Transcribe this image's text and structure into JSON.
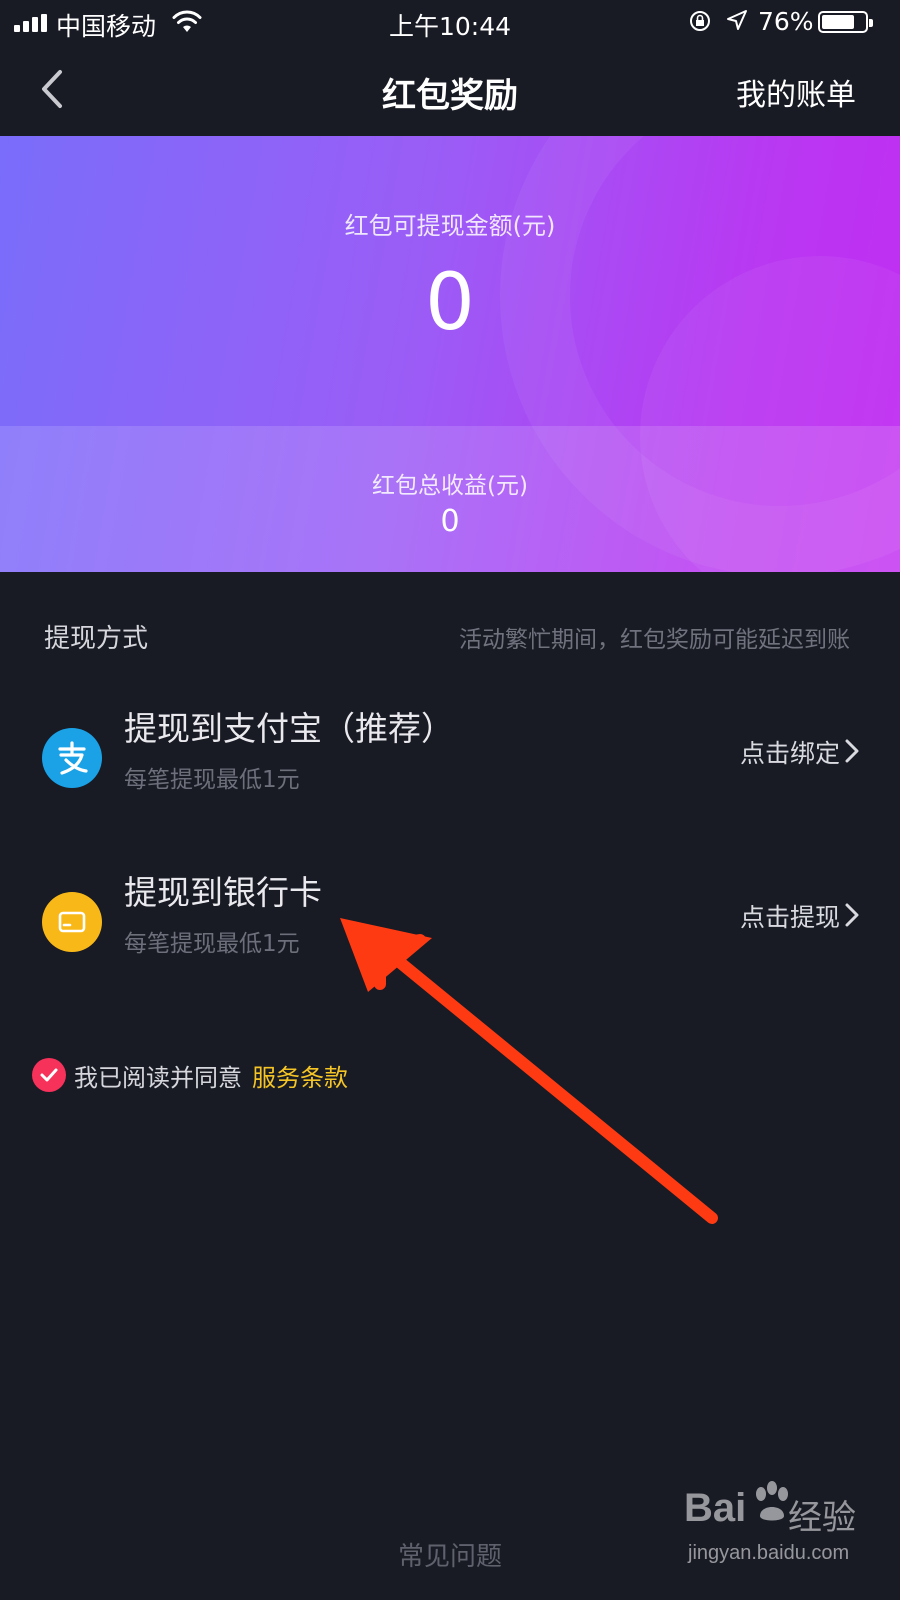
{
  "status_bar": {
    "carrier": "中国移动",
    "time": "上午10:44",
    "battery_percent": "76%",
    "battery_level": 0.76
  },
  "nav": {
    "title": "红包奖励",
    "right_label": "我的账单"
  },
  "banner": {
    "available_label": "红包可提现金额(元)",
    "available_value": "0",
    "total_label": "红包总收益(元)",
    "total_value": "0"
  },
  "withdraw": {
    "section_title": "提现方式",
    "section_note": "活动繁忙期间，红包奖励可能延迟到账",
    "methods": [
      {
        "title": "提现到支付宝（推荐）",
        "subtitle": "每笔提现最低1元",
        "action": "点击绑定",
        "icon": "alipay-icon",
        "icon_color": "#1aa1e6"
      },
      {
        "title": "提现到银行卡",
        "subtitle": "每笔提现最低1元",
        "action": "点击提现",
        "icon": "bank-card-icon",
        "icon_color": "#f8b818"
      }
    ]
  },
  "agreement": {
    "text": "我已阅读并同意",
    "link": "服务条款",
    "checked": true
  },
  "footer": {
    "faq": "常见问题"
  },
  "watermark": {
    "brand": "Bai",
    "brand_suffix": "经验",
    "url": "jingyan.baidu.com"
  },
  "colors": {
    "background": "#181a24",
    "accent_yellow": "#f5c526",
    "check_red": "#f6315a",
    "annotation_arrow": "#fe3a12"
  }
}
